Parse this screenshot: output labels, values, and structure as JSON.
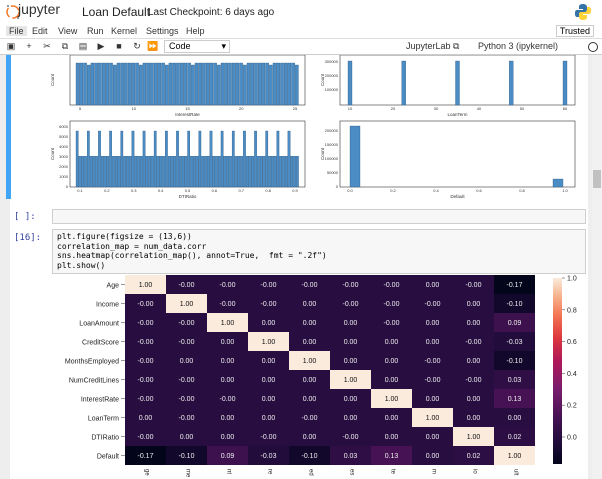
{
  "header": {
    "logo_text": "jupyter",
    "notebook_title": "Loan Default",
    "checkpoint": "Last Checkpoint: 6 days ago"
  },
  "menu": {
    "items": [
      "File",
      "Edit",
      "View",
      "Run",
      "Kernel",
      "Settings",
      "Help"
    ],
    "trusted": "Trusted"
  },
  "toolbar": {
    "cell_type": "Code",
    "jupyterlab": "JupyterLab",
    "kernel": "Python 3 (ipykernel)"
  },
  "empty_cell": {
    "prompt": "[ ]:"
  },
  "code_cell": {
    "prompt": "[16]:",
    "lines": [
      "plt.figure(figsize = (13,6))",
      "correlation_map = num_data.corr",
      "sns.heatmap(correlation_map(), annot=True,  fmt = \".2f\")",
      "plt.show()"
    ]
  },
  "histograms": {
    "top_left_xlabel": "InterestRate",
    "top_right_xlabel": "LoanTerm",
    "bottom_left_xlabel": "DTIRatio",
    "bottom_right_xlabel": "Default",
    "ylabel": "Count",
    "top_left_xticks": [
      "5",
      "10",
      "15",
      "20",
      "25"
    ],
    "top_right_xticks": [
      "10",
      "20",
      "30",
      "40",
      "50",
      "60"
    ],
    "bottom_left_xticks": [
      "0.1",
      "0.2",
      "0.3",
      "0.4",
      "0.5",
      "0.6",
      "0.7",
      "0.8",
      "0.9"
    ],
    "bottom_right_xticks": [
      "0.0",
      "0.2",
      "0.4",
      "0.6",
      "0.8",
      "1.0"
    ],
    "bottom_left_yticks": [
      "0",
      "1000",
      "2000",
      "3000",
      "4000",
      "5000",
      "6000"
    ],
    "bottom_right_yticks": [
      "0",
      "50000",
      "100000",
      "150000",
      "200000"
    ]
  },
  "chart_data": {
    "type": "heatmap",
    "rows": [
      "Age",
      "Income",
      "LoanAmount",
      "CreditScore",
      "MonthsEmployed",
      "NumCreditLines",
      "InterestRate",
      "LoanTerm",
      "DTIRatio",
      "Default"
    ],
    "col_labels": [
      "ge",
      "me",
      "nt",
      "re",
      "ed",
      "es",
      "te",
      "m",
      "io",
      "ult"
    ],
    "values": [
      [
        "1.00",
        "-0.00",
        "-0.00",
        "-0.00",
        "-0.00",
        "-0.00",
        "-0.00",
        "0.00",
        "-0.00",
        "-0.17"
      ],
      [
        "-0.00",
        "1.00",
        "-0.00",
        "-0.00",
        "0.00",
        "-0.00",
        "-0.00",
        "-0.00",
        "0.00",
        "-0.10"
      ],
      [
        "-0.00",
        "-0.00",
        "1.00",
        "0.00",
        "0.00",
        "0.00",
        "-0.00",
        "0.00",
        "0.00",
        "0.09"
      ],
      [
        "-0.00",
        "-0.00",
        "0.00",
        "1.00",
        "0.00",
        "0.00",
        "0.00",
        "0.00",
        "-0.00",
        "-0.03"
      ],
      [
        "-0.00",
        "0.00",
        "0.00",
        "0.00",
        "1.00",
        "0.00",
        "0.00",
        "-0.00",
        "0.00",
        "-0.10"
      ],
      [
        "-0.00",
        "-0.00",
        "0.00",
        "0.00",
        "0.00",
        "1.00",
        "0.00",
        "-0.00",
        "-0.00",
        "0.03"
      ],
      [
        "-0.00",
        "-0.00",
        "-0.00",
        "0.00",
        "0.00",
        "0.00",
        "1.00",
        "0.00",
        "0.00",
        "0.13"
      ],
      [
        "0.00",
        "-0.00",
        "0.00",
        "0.00",
        "-0.00",
        "0.00",
        "0.00",
        "1.00",
        "0.00",
        "0.00"
      ],
      [
        "-0.00",
        "0.00",
        "0.00",
        "-0.00",
        "0.00",
        "-0.00",
        "0.00",
        "0.00",
        "1.00",
        "0.02"
      ],
      [
        "-0.17",
        "-0.10",
        "0.09",
        "-0.03",
        "-0.10",
        "0.03",
        "0.13",
        "0.00",
        "0.02",
        "1.00"
      ]
    ],
    "colorbar_ticks": [
      "1.0",
      "0.8",
      "0.6",
      "0.4",
      "0.2",
      "0.0"
    ],
    "vmin": -0.17,
    "vmax": 1.0
  }
}
